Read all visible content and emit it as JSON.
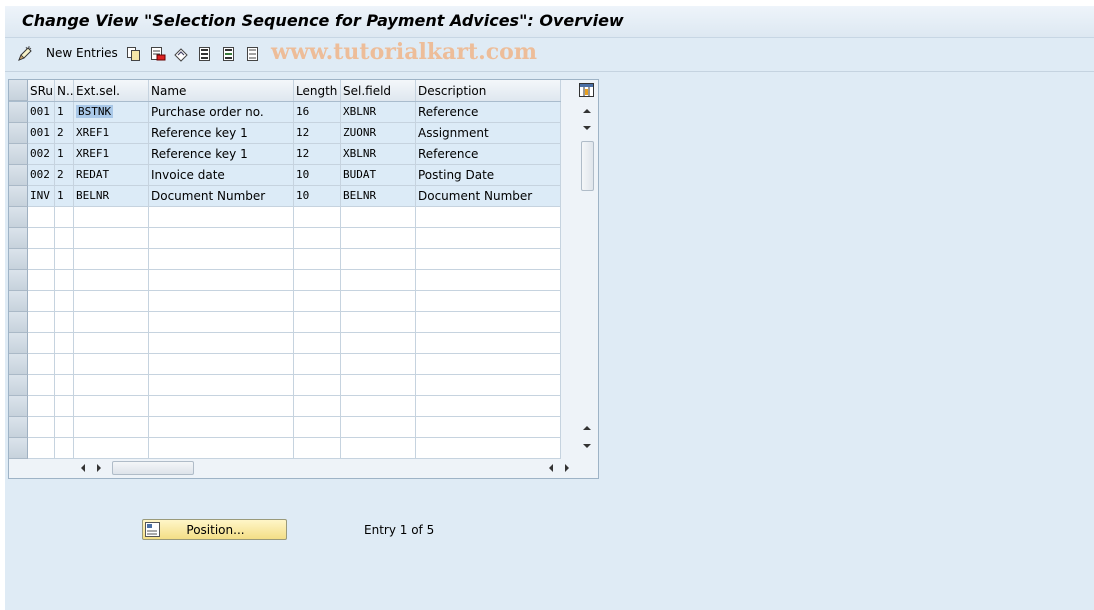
{
  "window": {
    "title": "Change View \"Selection Sequence for Payment Advices\": Overview"
  },
  "toolbar": {
    "new_entries_label": "New Entries",
    "watermark": "www.tutorialkart.com"
  },
  "table": {
    "columns": [
      "SRu",
      "N..",
      "Ext.sel.",
      "Name",
      "Length",
      "Sel.field",
      "Description"
    ],
    "rows": [
      {
        "sru": "001",
        "n": "1",
        "ext": "BSTNK",
        "name": "Purchase order no.",
        "length": "16",
        "selfield": "XBLNR",
        "desc": "Reference"
      },
      {
        "sru": "001",
        "n": "2",
        "ext": "XREF1",
        "name": "Reference key 1",
        "length": "12",
        "selfield": "ZUONR",
        "desc": "Assignment"
      },
      {
        "sru": "002",
        "n": "1",
        "ext": "XREF1",
        "name": "Reference key 1",
        "length": "12",
        "selfield": "XBLNR",
        "desc": "Reference"
      },
      {
        "sru": "002",
        "n": "2",
        "ext": "REDAT",
        "name": "Invoice date",
        "length": "10",
        "selfield": "BUDAT",
        "desc": "Posting Date"
      },
      {
        "sru": "INV",
        "n": "1",
        "ext": "BELNR",
        "name": "Document Number",
        "length": "10",
        "selfield": "BELNR",
        "desc": "Document Number"
      }
    ]
  },
  "footer": {
    "position_label": "Position...",
    "entry_info": "Entry 1 of 5"
  },
  "colors": {
    "frame_bg": "#dfebf5",
    "row_filled": "#dcebf7",
    "button_bg": "#f3de86"
  }
}
